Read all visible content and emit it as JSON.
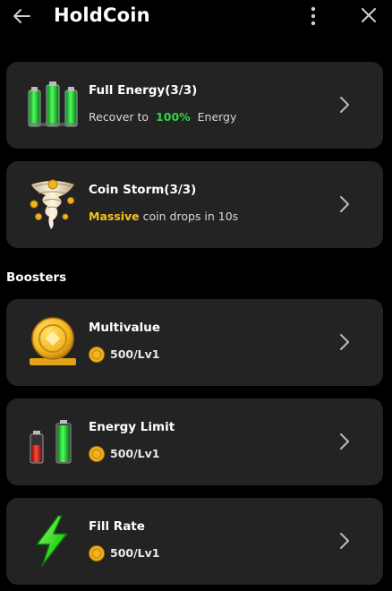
{
  "header": {
    "title": "HoldCoin"
  },
  "daily": [
    {
      "name": "Full Energy(3/3)",
      "desc_prefix": "Recover to",
      "desc_highlight": "100%",
      "desc_suffix": "Energy",
      "highlight_color": "#32d24a",
      "icon": "full-battery-icon"
    },
    {
      "name": "Coin Storm(3/3)",
      "desc_highlight": "Massive",
      "desc_suffix": "coin drops in 10s",
      "highlight_color": "#f5c21b",
      "icon": "coin-tornado-icon"
    }
  ],
  "boosters": {
    "heading": "Boosters",
    "items": [
      {
        "name": "Multivalue",
        "cost": "500/Lv1",
        "icon": "gold-coin-icon"
      },
      {
        "name": "Energy Limit",
        "cost": "500/Lv1",
        "icon": "battery-levels-icon"
      },
      {
        "name": "Fill Rate",
        "cost": "500/Lv1",
        "icon": "lightning-bolt-icon"
      }
    ]
  }
}
